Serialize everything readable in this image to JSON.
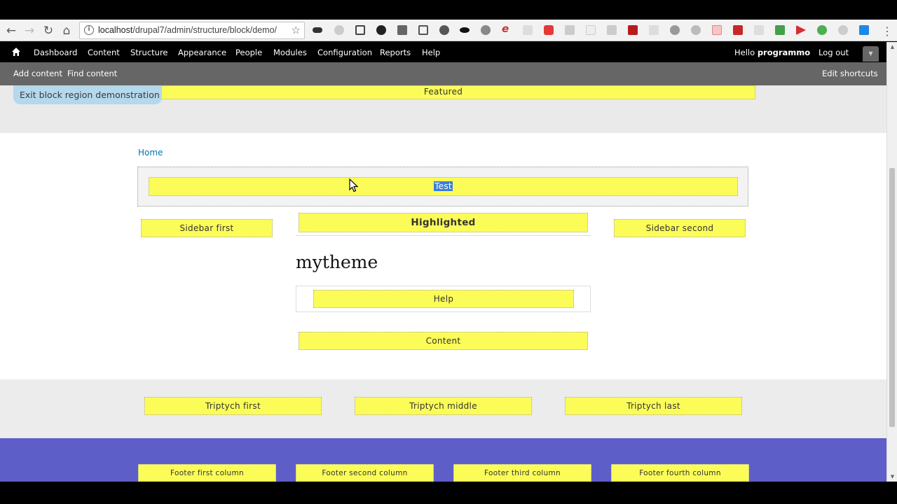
{
  "browser": {
    "url_host": "localhost",
    "url_path": "/drupal7/admin/structure/block/demo/"
  },
  "toolbar": {
    "items": [
      "Dashboard",
      "Content",
      "Structure",
      "Appearance",
      "People",
      "Modules",
      "Configuration",
      "Reports",
      "Help"
    ],
    "hello_prefix": "Hello ",
    "username": "programmo",
    "logout": "Log out"
  },
  "shortcuts": {
    "add_content": "Add content",
    "find_content": "Find content",
    "edit_shortcuts": "Edit shortcuts"
  },
  "page": {
    "exit_demo": "Exit block region demonstration",
    "featured": "Featured",
    "breadcrumb": "Home",
    "header_region": "Test",
    "sidebar_first": "Sidebar first",
    "highlighted": "Highlighted",
    "sidebar_second": "Sidebar second",
    "site_name": "mytheme",
    "help": "Help",
    "content": "Content",
    "triptych_first": "Triptych first",
    "triptych_middle": "Triptych middle",
    "triptych_last": "Triptych last",
    "footer_first": "Footer first column",
    "footer_second": "Footer second column",
    "footer_third": "Footer third column",
    "footer_fourth": "Footer fourth column"
  },
  "colors": {
    "region_yellow": "#fcfc58",
    "footer_purple": "#5e5ec8",
    "link_blue": "#0071b3"
  }
}
